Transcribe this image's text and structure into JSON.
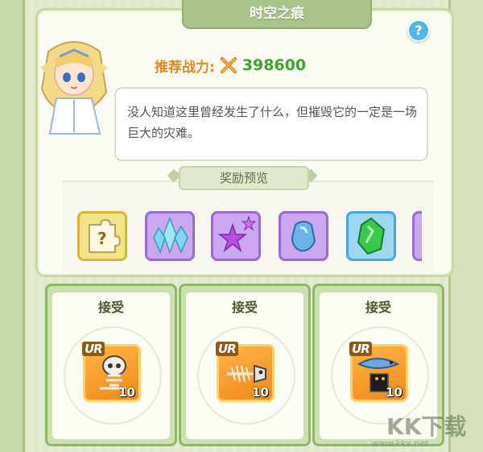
{
  "title": "时空之痕",
  "help_icon": "?",
  "recommended_power": {
    "label": "推荐战力:",
    "value": "398600",
    "icon": "crossed-swords-icon"
  },
  "description": "没人知道这里曾经发生了什么，但摧毁它的一定是一场巨大的灾难。",
  "rewards": {
    "title": "奖励预览",
    "items": [
      {
        "name": "mystery-puzzle",
        "icon": "question-puzzle-icon",
        "border": "#d8b43a",
        "bg": "#f3e48c"
      },
      {
        "name": "ice-crystal",
        "icon": "blue-crystal-icon",
        "border": "#9a6ad0",
        "bg": "#c9a8ef"
      },
      {
        "name": "purple-stars",
        "icon": "purple-star-icon",
        "border": "#9a6ad0",
        "bg": "#c9a8ef"
      },
      {
        "name": "blue-stone",
        "icon": "blue-stone-icon",
        "border": "#9a6ad0",
        "bg": "#c9a8ef"
      },
      {
        "name": "green-gem",
        "icon": "green-gem-icon",
        "border": "#4aa6d8",
        "bg": "#9fd6f2"
      }
    ]
  },
  "cards": [
    {
      "label": "接受",
      "badge": "UR",
      "count": "10",
      "icon": "skull-skeleton-icon"
    },
    {
      "label": "接受",
      "badge": "UR",
      "count": "10",
      "icon": "fish-skeleton-icon"
    },
    {
      "label": "接受",
      "badge": "UR",
      "count": "10",
      "icon": "fish-boot-icon"
    }
  ],
  "watermark": {
    "text": "KK下载",
    "url": "www.kkx.net"
  }
}
